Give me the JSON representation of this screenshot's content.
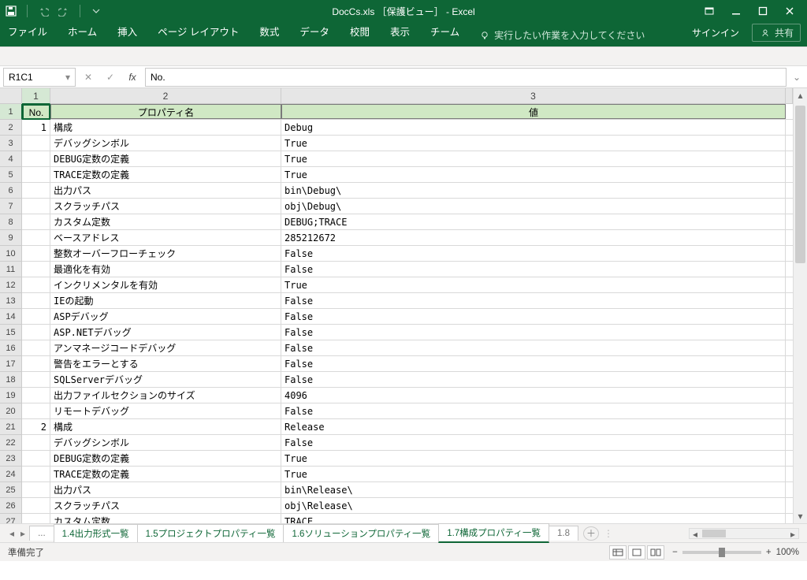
{
  "title": "DocCs.xls ［保護ビュー］ - Excel",
  "ribbon": {
    "tabs": [
      "ファイル",
      "ホーム",
      "挿入",
      "ページ レイアウト",
      "数式",
      "データ",
      "校閲",
      "表示",
      "チーム"
    ],
    "tell_me": "実行したい作業を入力してください",
    "sign_in": "サインイン",
    "share": "共有"
  },
  "formula_bar": {
    "name_box": "R1C1",
    "formula": "No."
  },
  "columns": [
    "1",
    "2",
    "3"
  ],
  "header_row": {
    "c1": "No.",
    "c2": "プロパティ名",
    "c3": "値"
  },
  "rows": [
    {
      "no": "1",
      "name": "構成",
      "val": "Debug"
    },
    {
      "no": "",
      "name": "デバッグシンボル",
      "val": "True"
    },
    {
      "no": "",
      "name": "DEBUG定数の定義",
      "val": "True"
    },
    {
      "no": "",
      "name": "TRACE定数の定義",
      "val": "True"
    },
    {
      "no": "",
      "name": "出力パス",
      "val": "bin\\Debug\\"
    },
    {
      "no": "",
      "name": "スクラッチパス",
      "val": "obj\\Debug\\"
    },
    {
      "no": "",
      "name": "カスタム定数",
      "val": "DEBUG;TRACE"
    },
    {
      "no": "",
      "name": "ベースアドレス",
      "val": "285212672"
    },
    {
      "no": "",
      "name": "整数オーバーフローチェック",
      "val": "False"
    },
    {
      "no": "",
      "name": "最適化を有効",
      "val": "False"
    },
    {
      "no": "",
      "name": "インクリメンタルを有効",
      "val": "True"
    },
    {
      "no": "",
      "name": "IEの起動",
      "val": "False"
    },
    {
      "no": "",
      "name": "ASPデバッグ",
      "val": "False"
    },
    {
      "no": "",
      "name": "ASP.NETデバッグ",
      "val": "False"
    },
    {
      "no": "",
      "name": "アンマネージコードデバッグ",
      "val": "False"
    },
    {
      "no": "",
      "name": "警告をエラーとする",
      "val": "False"
    },
    {
      "no": "",
      "name": "SQLServerデバッグ",
      "val": "False"
    },
    {
      "no": "",
      "name": "出力ファイルセクションのサイズ",
      "val": "4096"
    },
    {
      "no": "",
      "name": "リモートデバッグ",
      "val": "False"
    },
    {
      "no": "2",
      "name": "構成",
      "val": "Release"
    },
    {
      "no": "",
      "name": "デバッグシンボル",
      "val": "False"
    },
    {
      "no": "",
      "name": "DEBUG定数の定義",
      "val": "True"
    },
    {
      "no": "",
      "name": "TRACE定数の定義",
      "val": "True"
    },
    {
      "no": "",
      "name": "出力パス",
      "val": "bin\\Release\\"
    },
    {
      "no": "",
      "name": "スクラッチパス",
      "val": "obj\\Release\\"
    },
    {
      "no": "",
      "name": "カスタム定数",
      "val": "TRACE"
    }
  ],
  "sheet_tabs": {
    "prev_more": "...",
    "items": [
      "1.4出力形式一覧",
      "1.5プロジェクトプロパティ一覧",
      "1.6ソリューションプロパティ一覧",
      "1.7構成プロパティ一覧"
    ],
    "next_partial": "1.8",
    "active_index": 3
  },
  "statusbar": {
    "ready": "準備完了",
    "zoom": "100%"
  }
}
